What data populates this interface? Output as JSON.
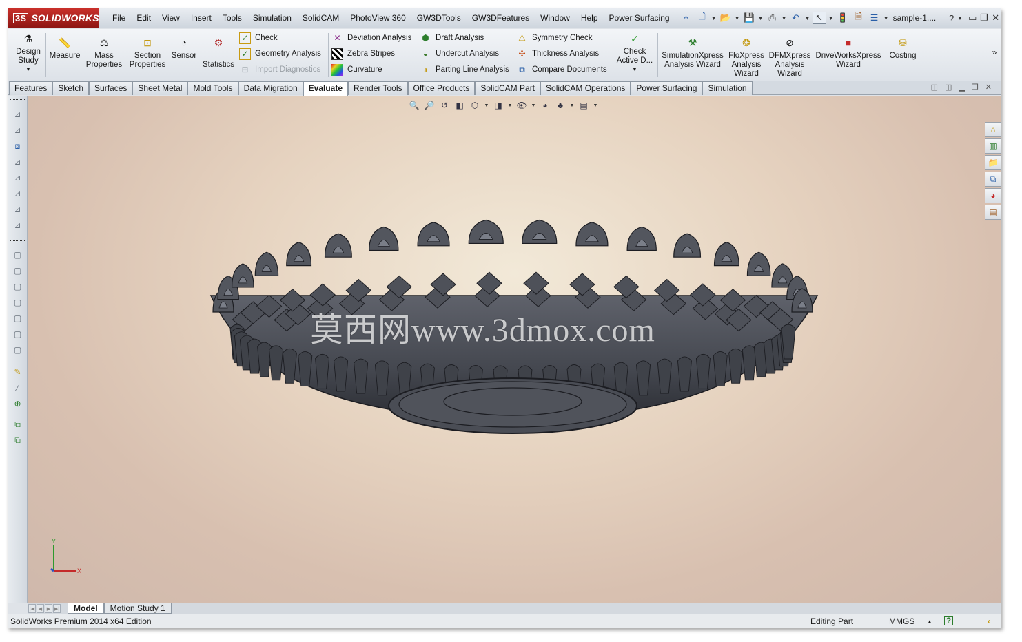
{
  "app": {
    "brand": "SOLIDWORKS",
    "brand_mark": "3S",
    "document_title": "sample-1...."
  },
  "menu": [
    "File",
    "Edit",
    "View",
    "Insert",
    "Tools",
    "Simulation",
    "SolidCAM",
    "PhotoView 360",
    "GW3DTools",
    "GW3DFeatures",
    "Window",
    "Help",
    "Power Surfacing"
  ],
  "quick_access": [
    "pin-icon",
    "new-document-icon",
    "open-icon",
    "save-icon",
    "print-icon",
    "undo-icon",
    "select-icon",
    "rebuild-icon",
    "file-properties-icon",
    "options-icon"
  ],
  "window_controls": {
    "help": "?",
    "minimize": "▭",
    "restore": "❐",
    "close": "✕"
  },
  "ribbon": {
    "design_study": "Design Study",
    "measure": "Measure",
    "mass_properties": "Mass Properties",
    "section_properties": "Section Properties",
    "sensor": "Sensor",
    "statistics": "Statistics",
    "check": "Check",
    "geometry_analysis": "Geometry Analysis",
    "import_diagnostics": "Import Diagnostics",
    "deviation_analysis": "Deviation Analysis",
    "zebra_stripes": "Zebra Stripes",
    "curvature": "Curvature",
    "draft_analysis": "Draft Analysis",
    "undercut_analysis": "Undercut Analysis",
    "parting_line_analysis": "Parting Line Analysis",
    "symmetry_check": "Symmetry Check",
    "thickness_analysis": "Thickness Analysis",
    "compare_documents": "Compare Documents",
    "check_active": "Check Active D...",
    "simxpress": "SimulationXpress Analysis Wizard",
    "floxpress": "FloXpress Analysis Wizard",
    "dfmxpress": "DFMXpress Analysis Wizard",
    "driveworks": "DriveWorksXpress Wizard",
    "costing": "Costing",
    "overflow": "»"
  },
  "tabs": [
    "Features",
    "Sketch",
    "Surfaces",
    "Sheet Metal",
    "Mold Tools",
    "Data Migration",
    "Evaluate",
    "Render Tools",
    "Office Products",
    "SolidCAM Part",
    "SolidCAM Operations",
    "Power Surfacing",
    "Simulation"
  ],
  "active_tab": "Evaluate",
  "viewport": {
    "watermark": "莫西网www.3dmox.com",
    "triad_y": "Y",
    "triad_x": "X",
    "model_colors": {
      "body": "#4a4d55",
      "edge": "#1c1d22",
      "highlight": "#7a7e88"
    }
  },
  "heads_up": [
    "zoom-to-fit-icon",
    "zoom-area-icon",
    "previous-view-icon",
    "section-view-icon",
    "view-orientation-icon",
    "display-style-icon",
    "hide-show-icon",
    "edit-appearance-icon",
    "apply-scene-icon",
    "view-settings-icon"
  ],
  "task_pane": [
    "home-icon",
    "design-library-icon",
    "file-explorer-icon",
    "view-palette-icon",
    "appearances-icon",
    "custom-properties-icon"
  ],
  "model_tabs": [
    "Model",
    "Motion Study 1"
  ],
  "active_model_tab": "Model",
  "status": {
    "edition": "SolidWorks Premium 2014 x64 Edition",
    "mode": "Editing Part",
    "units": "MMGS",
    "units_arrow": "▲",
    "help": "?",
    "expand": "‹"
  }
}
